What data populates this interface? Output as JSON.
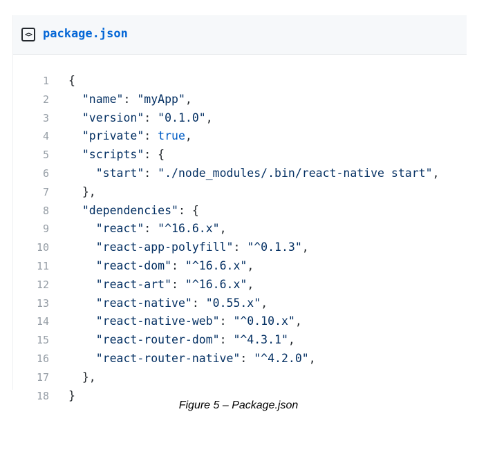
{
  "file": {
    "name": "package.json",
    "icon": "code-file-icon"
  },
  "code_lines": [
    {
      "n": "1",
      "parts": [
        [
          "p",
          "{"
        ]
      ],
      "indent": 0
    },
    {
      "n": "2",
      "parts": [
        [
          "s",
          "\"name\""
        ],
        [
          "p",
          ": "
        ],
        [
          "s",
          "\"myApp\""
        ],
        [
          "p",
          ","
        ]
      ],
      "indent": 1
    },
    {
      "n": "3",
      "parts": [
        [
          "s",
          "\"version\""
        ],
        [
          "p",
          ": "
        ],
        [
          "s",
          "\"0.1.0\""
        ],
        [
          "p",
          ","
        ]
      ],
      "indent": 1
    },
    {
      "n": "4",
      "parts": [
        [
          "s",
          "\"private\""
        ],
        [
          "p",
          ": "
        ],
        [
          "k",
          "true"
        ],
        [
          "p",
          ","
        ]
      ],
      "indent": 1
    },
    {
      "n": "5",
      "parts": [
        [
          "s",
          "\"scripts\""
        ],
        [
          "p",
          ": {"
        ]
      ],
      "indent": 1
    },
    {
      "n": "6",
      "parts": [
        [
          "s",
          "\"start\""
        ],
        [
          "p",
          ": "
        ],
        [
          "s",
          "\"./node_modules/.bin/react-native start\""
        ],
        [
          "p",
          ","
        ]
      ],
      "indent": 2
    },
    {
      "n": "7",
      "parts": [
        [
          "p",
          "},"
        ]
      ],
      "indent": 1
    },
    {
      "n": "8",
      "parts": [
        [
          "s",
          "\"dependencies\""
        ],
        [
          "p",
          ": {"
        ]
      ],
      "indent": 1
    },
    {
      "n": "9",
      "parts": [
        [
          "s",
          "\"react\""
        ],
        [
          "p",
          ": "
        ],
        [
          "s",
          "\"^16.6.x\""
        ],
        [
          "p",
          ","
        ]
      ],
      "indent": 2
    },
    {
      "n": "10",
      "parts": [
        [
          "s",
          "\"react-app-polyfill\""
        ],
        [
          "p",
          ": "
        ],
        [
          "s",
          "\"^0.1.3\""
        ],
        [
          "p",
          ","
        ]
      ],
      "indent": 2
    },
    {
      "n": "11",
      "parts": [
        [
          "s",
          "\"react-dom\""
        ],
        [
          "p",
          ": "
        ],
        [
          "s",
          "\"^16.6.x\""
        ],
        [
          "p",
          ","
        ]
      ],
      "indent": 2
    },
    {
      "n": "12",
      "parts": [
        [
          "s",
          "\"react-art\""
        ],
        [
          "p",
          ": "
        ],
        [
          "s",
          "\"^16.6.x\""
        ],
        [
          "p",
          ","
        ]
      ],
      "indent": 2
    },
    {
      "n": "13",
      "parts": [
        [
          "s",
          "\"react-native\""
        ],
        [
          "p",
          ": "
        ],
        [
          "s",
          "\"0.55.x\""
        ],
        [
          "p",
          ","
        ]
      ],
      "indent": 2
    },
    {
      "n": "14",
      "parts": [
        [
          "s",
          "\"react-native-web\""
        ],
        [
          "p",
          ": "
        ],
        [
          "s",
          "\"^0.10.x\""
        ],
        [
          "p",
          ","
        ]
      ],
      "indent": 2
    },
    {
      "n": "15",
      "parts": [
        [
          "s",
          "\"react-router-dom\""
        ],
        [
          "p",
          ": "
        ],
        [
          "s",
          "\"^4.3.1\""
        ],
        [
          "p",
          ","
        ]
      ],
      "indent": 2
    },
    {
      "n": "16",
      "parts": [
        [
          "s",
          "\"react-router-native\""
        ],
        [
          "p",
          ": "
        ],
        [
          "s",
          "\"^4.2.0\""
        ],
        [
          "p",
          ","
        ]
      ],
      "indent": 2
    },
    {
      "n": "17",
      "parts": [
        [
          "p",
          "},"
        ]
      ],
      "indent": 1
    },
    {
      "n": "18",
      "parts": [
        [
          "p",
          "}"
        ]
      ],
      "indent": 0
    }
  ],
  "caption": "Figure 5 – Package.json"
}
